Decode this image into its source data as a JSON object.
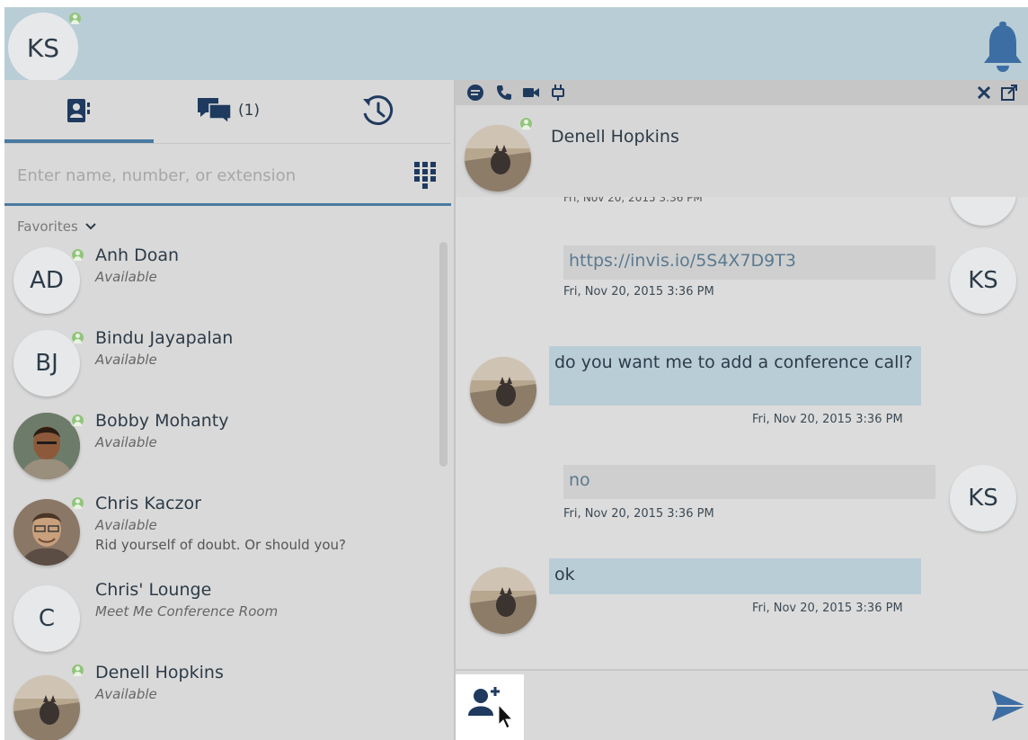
{
  "me": {
    "initials": "KS",
    "presence": "available"
  },
  "tabs": {
    "contacts_icon": "contact-card-icon",
    "chats_icon": "chat-bubbles-icon",
    "chats_count": "(1)",
    "history_icon": "history-icon"
  },
  "search": {
    "placeholder": "Enter name, number, or extension",
    "value": ""
  },
  "favorites": {
    "label": "Favorites"
  },
  "contacts": [
    {
      "initials": "AD",
      "name": "Anh Doan",
      "status": "Available",
      "note": "",
      "photo": false
    },
    {
      "initials": "BJ",
      "name": "Bindu Jayapalan",
      "status": "Available",
      "note": "",
      "photo": false
    },
    {
      "initials": "",
      "name": "Bobby Mohanty",
      "status": "Available",
      "note": "",
      "photo": true
    },
    {
      "initials": "",
      "name": "Chris Kaczor",
      "status": "Available",
      "note": "Rid yourself of doubt. Or should you?",
      "photo": true
    },
    {
      "initials": "C",
      "name": "Chris' Lounge",
      "status": "Meet Me Conference Room",
      "note": "",
      "photo": false
    },
    {
      "initials": "",
      "name": "Denell Hopkins",
      "status": "Available",
      "note": "",
      "photo": true
    }
  ],
  "conversation": {
    "toolbar_icons": [
      "chat-icon",
      "phone-icon",
      "video-icon",
      "plug-icon"
    ],
    "contact_name": "Denell Hopkins",
    "cut_timestamp": "Fri, Nov 20, 2015 3:36 PM",
    "messages": [
      {
        "from": "KS",
        "text": "https://invis.io/5S4X7D9T3",
        "time": "Fri, Nov 20, 2015 3:36 PM"
      },
      {
        "from": "Denell Hopkins",
        "text": "do you want me to add a conference call?",
        "time": "Fri, Nov 20, 2015 3:36 PM"
      },
      {
        "from": "KS",
        "text": "no",
        "time": "Fri, Nov 20, 2015 3:36 PM"
      },
      {
        "from": "Denell Hopkins",
        "text": "ok",
        "time": "Fri, Nov 20, 2015 3:36 PM"
      }
    ]
  },
  "colors": {
    "accent": "#4a7aa0",
    "header_bg": "#b9cdd6",
    "presence_green": "#93c47d",
    "incoming_bubble": "#b9cdd6",
    "outgoing_bubble": "#cfcfcf",
    "icon_navy": "#1f3a5f"
  }
}
